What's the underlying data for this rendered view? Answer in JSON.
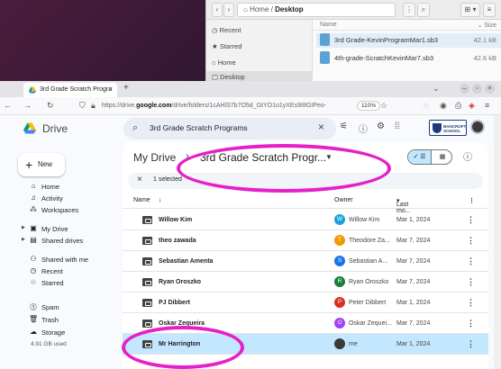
{
  "file_manager": {
    "path_home": "Home",
    "path_current": "Desktop",
    "col_name": "Name",
    "col_size": "Size",
    "sidebar": [
      "Recent",
      "Starred",
      "Home",
      "Desktop"
    ],
    "files": [
      {
        "name": "3rd Grade-KevinProgramMar1.sb3",
        "size": "42.1 kB"
      },
      {
        "name": "4th-grade-ScratchKevinMar7.sb3",
        "size": "42.6 kB"
      }
    ]
  },
  "browser": {
    "tab_title": "3rd Grade Scratch Progra",
    "url_prefix": "https://drive.",
    "url_domain": "google.com",
    "url_rest": "/drive/folders/1cAHlS7b7O5d_GtYO1o1yXEs9I8GIPeo-",
    "zoom": "110%"
  },
  "drive": {
    "logo_text": "Drive",
    "search_text": "3rd Grade Scratch Programs",
    "new_label": "New",
    "school_name": "BANCROFT SCHOOL",
    "nav": [
      "Home",
      "Activity",
      "Workspaces",
      "My Drive",
      "Shared drives",
      "Shared with me",
      "Recent",
      "Starred",
      "Spam",
      "Trash",
      "Storage"
    ],
    "storage_used": "4.91 GB used",
    "breadcrumb_root": "My Drive",
    "breadcrumb_current": "3rd Grade Scratch Progr...",
    "selected_text": "1 selected",
    "col_name": "Name",
    "col_owner": "Owner",
    "col_modified": "Last mo...",
    "rows": [
      {
        "name": "Willow Kim",
        "owner": "Willow Kim",
        "initial": "W",
        "color": "#1aa3d9",
        "modified": "Mar 1, 2024"
      },
      {
        "name": "theo zawada",
        "owner": "Theodore Za...",
        "initial": "T",
        "color": "#f29900",
        "modified": "Mar 7, 2024"
      },
      {
        "name": "Sebastian Amenta",
        "owner": "Sebastian A...",
        "initial": "S",
        "color": "#1a73e8",
        "modified": "Mar 7, 2024"
      },
      {
        "name": "Ryan Oroszko",
        "owner": "Ryan Oroszko",
        "initial": "R",
        "color": "#188038",
        "modified": "Mar 7, 2024"
      },
      {
        "name": "PJ Dibbert",
        "owner": "Peter Dibbert",
        "initial": "P",
        "color": "#d93025",
        "modified": "Mar 1, 2024"
      },
      {
        "name": "Oskar Zequeira",
        "owner": "Oskar Zequei...",
        "initial": "O",
        "color": "#a142f4",
        "modified": "Mar 7, 2024"
      },
      {
        "name": "Mr Harrington",
        "owner": "me",
        "initial": "",
        "color": "#3d3a36",
        "modified": "Mar 1, 2024"
      }
    ]
  }
}
